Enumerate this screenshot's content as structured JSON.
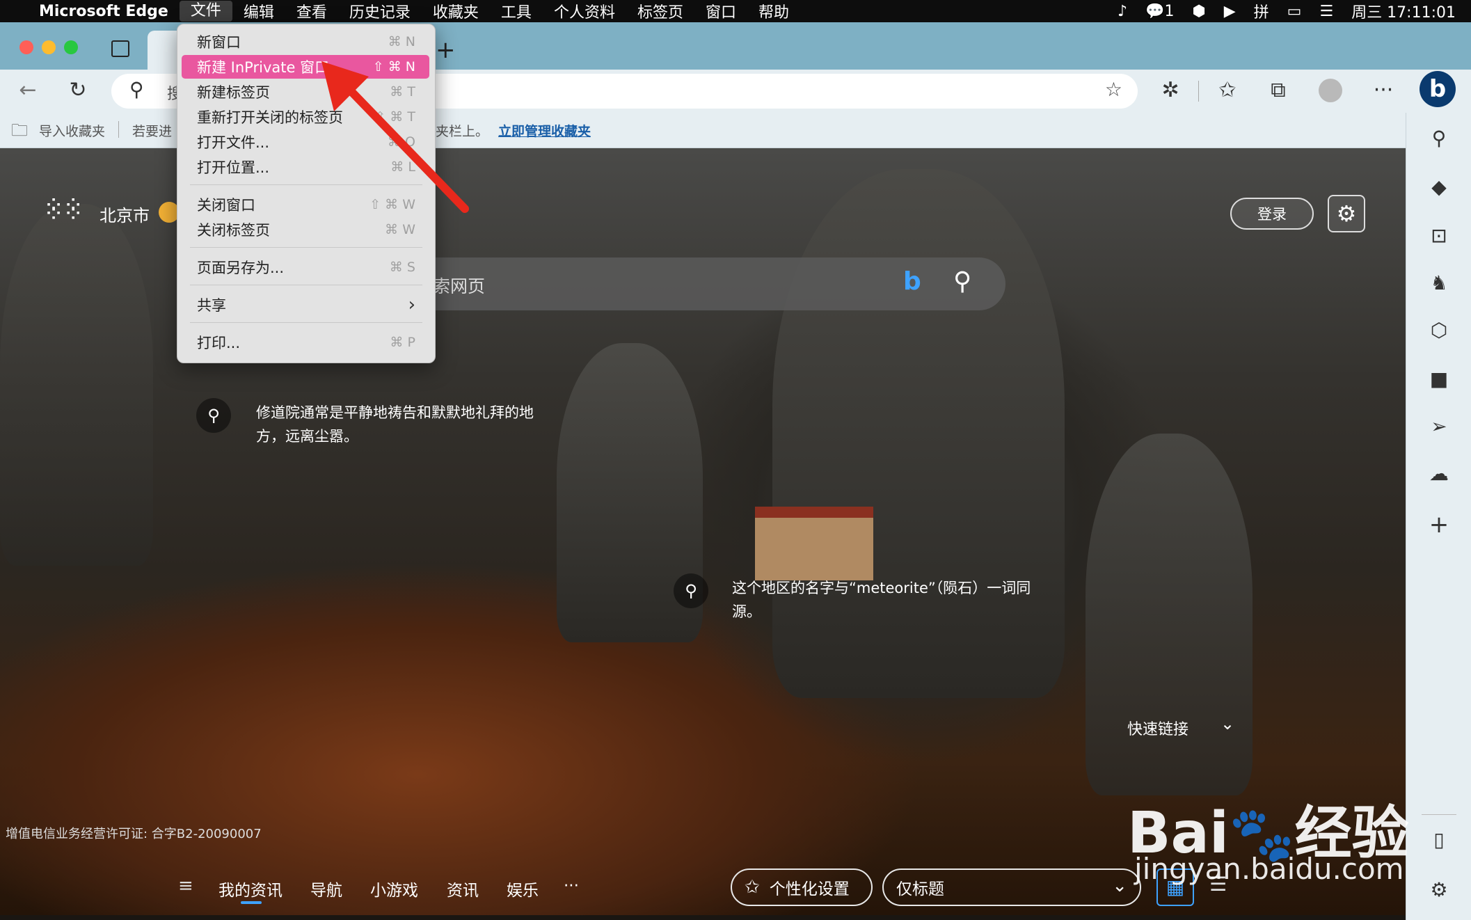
{
  "menubar": {
    "apple": "",
    "app": "Microsoft Edge",
    "items": [
      "文件",
      "编辑",
      "查看",
      "历史记录",
      "收藏夹",
      "工具",
      "个人资料",
      "标签页",
      "窗口",
      "帮助"
    ],
    "wechat_count": "1",
    "clock": "周三 17:11:01"
  },
  "favorites_bar": {
    "import": "导入收藏夹",
    "hint_left": "若要进",
    "hint_right": "夹栏上。",
    "manage_link": "立即管理收藏夹"
  },
  "address": {
    "partial": "搜"
  },
  "file_menu": {
    "items": [
      {
        "label": "新窗口",
        "shortcut": "⌘ N"
      },
      {
        "label": "新建 InPrivate 窗口",
        "shortcut": "⇧ ⌘ N"
      },
      {
        "label": "新建标签页",
        "shortcut": "⌘ T"
      },
      {
        "label": "重新打开关闭的标签页",
        "shortcut": "⇧ ⌘ T"
      },
      {
        "label": "打开文件...",
        "shortcut": "⌘ O"
      },
      {
        "label": "打开位置...",
        "shortcut": "⌘ L"
      },
      {
        "label": "关闭窗口",
        "shortcut": "⇧ ⌘ W"
      },
      {
        "label": "关闭标签页",
        "shortcut": "⌘ W"
      },
      {
        "label": "页面另存为...",
        "shortcut": "⌘ S"
      },
      {
        "label": "共享",
        "shortcut": "›"
      },
      {
        "label": "打印...",
        "shortcut": "⌘ P"
      }
    ]
  },
  "newtab": {
    "location": "北京市",
    "login": "登录",
    "search_placeholder": "索网页",
    "fact1": "修道院通常是平静地祷告和默默地礼拜的地方，远离尘嚣。",
    "fact2": "这个地区的名字与“meteorite”（陨石）一词同源。",
    "quick_links": "快速链接",
    "license": "增值电信业务经营许可证: 合字B2-20090007",
    "nav": [
      "我的资讯",
      "导航",
      "小游戏",
      "资讯",
      "娱乐",
      "···"
    ],
    "personalize": "个性化设置",
    "headline_mode": "仅标题"
  },
  "watermark": {
    "brand": "Bai",
    "brand2": "经验",
    "url": "jingyan.baidu.com"
  },
  "colors": {
    "menu_highlight": "#e9579f",
    "arrow": "#e8281c",
    "tabbar": "#7eb0c4"
  }
}
